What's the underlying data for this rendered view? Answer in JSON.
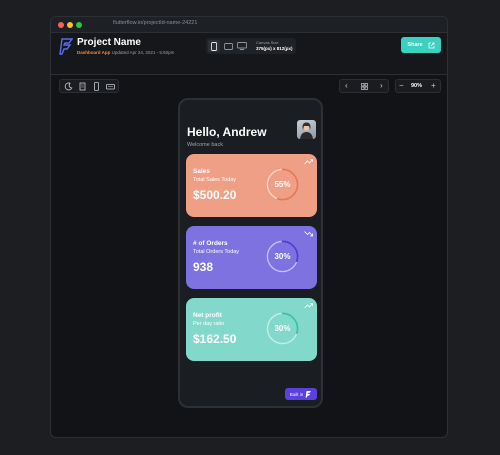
{
  "browser": {
    "url": "flutterflow.io/projectId-name-24221"
  },
  "header": {
    "title": "Project Name",
    "subtitle_accent": "Dashboard App",
    "subtitle_rest": "Updated Apr 24, 2021 - 5:50pm",
    "canvas_label": "Canvas Size",
    "canvas_value": "375(px) x 812(px)",
    "share_label": "Share"
  },
  "toolbar": {
    "zoom": "90%"
  },
  "app": {
    "greeting": "Hello, Andrew",
    "welcome": "Welcome back",
    "cards": [
      {
        "title": "Sales",
        "subtitle": "Total Sales Today",
        "value": "$500.20",
        "percent_label": "55%",
        "percent": 0.55,
        "color": "#ee9f86",
        "ring_color": "#e8785a"
      },
      {
        "title": "# of Orders",
        "subtitle": "Total Orders Today",
        "value": "938",
        "percent_label": "30%",
        "percent": 0.3,
        "color": "#7d72e0",
        "ring_color": "#4b3fd0"
      },
      {
        "title": "Net profit",
        "subtitle": "Per day ratio",
        "value": "$162.50",
        "percent_label": "30%",
        "percent": 0.3,
        "color": "#82d9cb",
        "ring_color": "#3fbfa9"
      }
    ],
    "built_badge": "Built in"
  },
  "colors": {
    "accent": "#39d2c0",
    "badge": "#5b3fe0",
    "highlight": "#f08a3c"
  }
}
